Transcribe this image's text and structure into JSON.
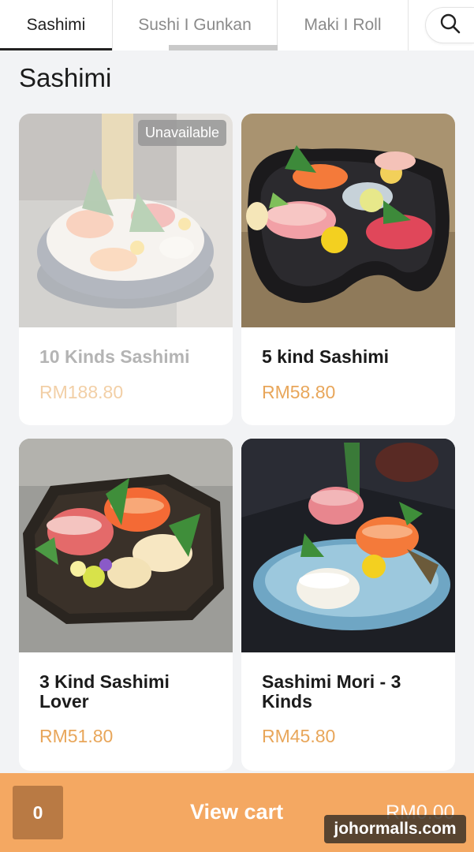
{
  "tabs": [
    {
      "label": "Sashimi",
      "active": true
    },
    {
      "label": "Sushi I Gunkan",
      "active": false
    },
    {
      "label": "Maki I Roll",
      "active": false
    }
  ],
  "search": {
    "icon": "search-icon"
  },
  "section": {
    "title": "Sashimi"
  },
  "products": [
    {
      "name": "10 Kinds Sashimi",
      "price": "RM188.80",
      "available": false,
      "badge": "Unavailable"
    },
    {
      "name": "5 kind Sashimi",
      "price": "RM58.80",
      "available": true
    },
    {
      "name": "3 Kind Sashimi Lover",
      "price": "RM51.80",
      "available": true
    },
    {
      "name": "Sashimi Mori - 3 Kinds",
      "price": "RM45.80",
      "available": true
    }
  ],
  "cart": {
    "count": "0",
    "label": "View cart",
    "total": "RM0.00"
  },
  "watermark": "johormalls.com",
  "colors": {
    "accent": "#f4a862",
    "price": "#e8a65a",
    "count_bg": "#b97a44"
  }
}
